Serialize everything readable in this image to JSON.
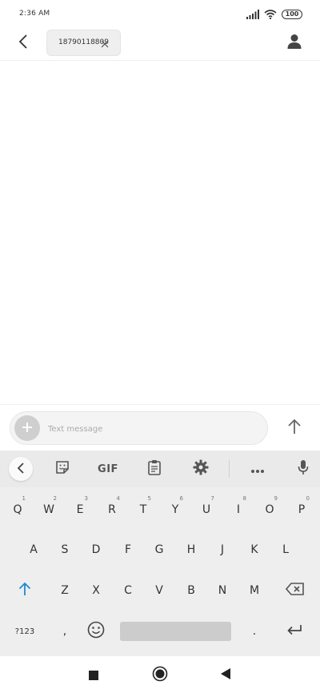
{
  "status_bar": {
    "time": "2:36 AM",
    "battery": "100"
  },
  "header": {
    "recipient": "18790118809"
  },
  "compose": {
    "placeholder": "Text message"
  },
  "keyboard": {
    "toolbar": {
      "gif_label": "GIF"
    },
    "row1": [
      {
        "label": "Q",
        "hint": "1"
      },
      {
        "label": "W",
        "hint": "2"
      },
      {
        "label": "E",
        "hint": "3"
      },
      {
        "label": "R",
        "hint": "4"
      },
      {
        "label": "T",
        "hint": "5"
      },
      {
        "label": "Y",
        "hint": "6"
      },
      {
        "label": "U",
        "hint": "7"
      },
      {
        "label": "I",
        "hint": "8"
      },
      {
        "label": "O",
        "hint": "9"
      },
      {
        "label": "P",
        "hint": "0"
      }
    ],
    "row2": [
      "A",
      "S",
      "D",
      "F",
      "G",
      "H",
      "J",
      "K",
      "L"
    ],
    "row3": [
      "Z",
      "X",
      "C",
      "V",
      "B",
      "N",
      "M"
    ],
    "row4": {
      "symbols": "?123",
      "comma": ",",
      "period": "."
    }
  },
  "colors": {
    "shift_active": "#1a8cd8",
    "background": "#ffffff",
    "keyboard_bg": "#eeeeee"
  }
}
